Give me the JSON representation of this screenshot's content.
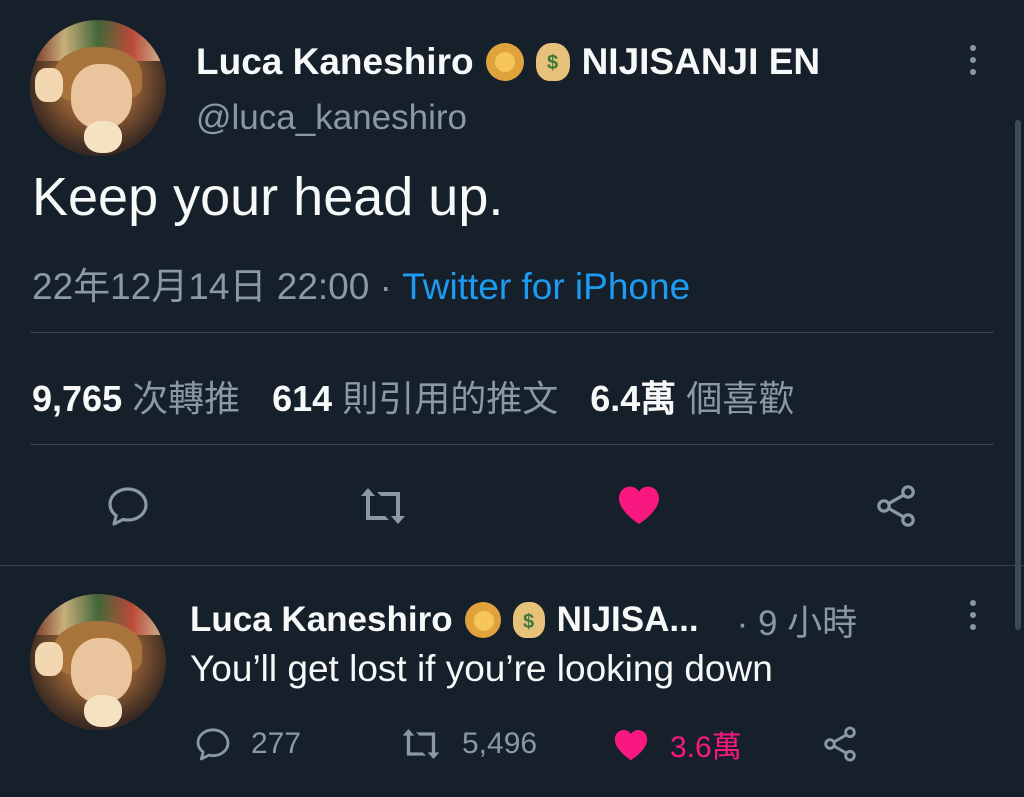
{
  "tweet": {
    "author_name": "Luca Kaneshiro",
    "affiliation": "NIJISANJI EN",
    "handle": "@luca_kaneshiro",
    "text": "Keep your head up.",
    "timestamp": "22年12月14日 22:00",
    "separator": "·",
    "source": "Twitter for iPhone",
    "stats": {
      "retweets_value": "9,765",
      "retweets_label": "次轉推",
      "quotes_value": "614",
      "quotes_label": "則引用的推文",
      "likes_value": "6.4萬",
      "likes_label": "個喜歡"
    },
    "liked": true
  },
  "reply": {
    "author_name": "Luca Kaneshiro",
    "affiliation_truncated": "NIJISA...",
    "time": "· 9 小時",
    "text": "You’ll get lost if you’re looking down",
    "reply_count": "277",
    "retweet_count": "5,496",
    "like_count": "3.6萬",
    "liked": true
  },
  "icons": {
    "badge_1": "lion-emoji",
    "badge_2": "money-bag-emoji"
  },
  "colors": {
    "background": "#15202b",
    "like_pink": "#f91880",
    "link_blue": "#1d9bf0",
    "muted": "#8b98a5"
  }
}
